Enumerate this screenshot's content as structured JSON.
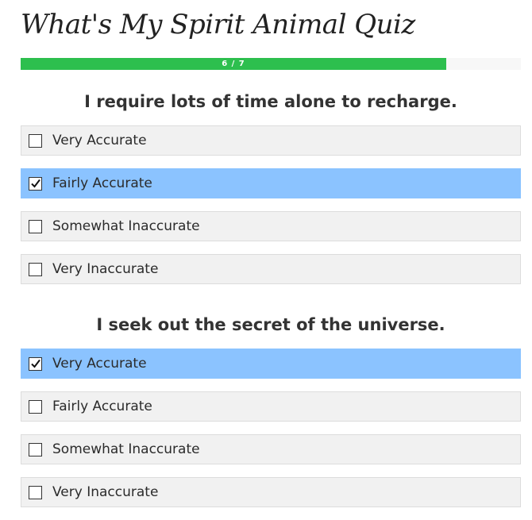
{
  "quiz": {
    "title": "What's My Spirit Animal Quiz"
  },
  "progress": {
    "current": 6,
    "total": 7,
    "label": "6 / 7",
    "fraction": 0.85
  },
  "questions": [
    {
      "text": "I require lots of time alone to recharge.",
      "selected_index": 1,
      "options": [
        {
          "label": "Very Accurate"
        },
        {
          "label": "Fairly Accurate"
        },
        {
          "label": "Somewhat Inaccurate"
        },
        {
          "label": "Very Inaccurate"
        }
      ]
    },
    {
      "text": "I seek out the secret of the universe.",
      "selected_index": 0,
      "options": [
        {
          "label": "Very Accurate"
        },
        {
          "label": "Fairly Accurate"
        },
        {
          "label": "Somewhat Inaccurate"
        },
        {
          "label": "Very Inaccurate"
        }
      ]
    }
  ],
  "colors": {
    "progress_fill": "#2dbf4e",
    "selected_answer": "#8bc3ff",
    "answer_background": "#f1f1f1"
  }
}
